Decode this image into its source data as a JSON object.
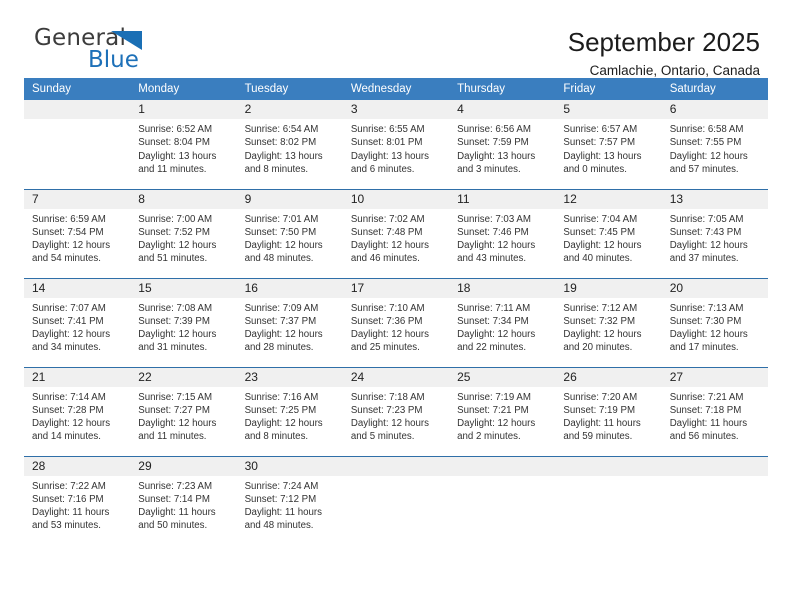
{
  "brand": {
    "name_top": "General",
    "name_bottom": "Blue",
    "triangle_color": "#1a6fb5"
  },
  "header": {
    "title": "September 2025",
    "subtitle": "Camlachie, Ontario, Canada"
  },
  "theme": {
    "header_row_bg": "#3a7ebf",
    "daynum_bg": "#f0f0f0",
    "row_divider": "#2f6fa8",
    "text": "#333333"
  },
  "weekdays": [
    "Sunday",
    "Monday",
    "Tuesday",
    "Wednesday",
    "Thursday",
    "Friday",
    "Saturday"
  ],
  "weeks": [
    [
      {
        "day": "",
        "lines": []
      },
      {
        "day": "1",
        "lines": [
          "Sunrise: 6:52 AM",
          "Sunset: 8:04 PM",
          "Daylight: 13 hours",
          "and 11 minutes."
        ]
      },
      {
        "day": "2",
        "lines": [
          "Sunrise: 6:54 AM",
          "Sunset: 8:02 PM",
          "Daylight: 13 hours",
          "and 8 minutes."
        ]
      },
      {
        "day": "3",
        "lines": [
          "Sunrise: 6:55 AM",
          "Sunset: 8:01 PM",
          "Daylight: 13 hours",
          "and 6 minutes."
        ]
      },
      {
        "day": "4",
        "lines": [
          "Sunrise: 6:56 AM",
          "Sunset: 7:59 PM",
          "Daylight: 13 hours",
          "and 3 minutes."
        ]
      },
      {
        "day": "5",
        "lines": [
          "Sunrise: 6:57 AM",
          "Sunset: 7:57 PM",
          "Daylight: 13 hours",
          "and 0 minutes."
        ]
      },
      {
        "day": "6",
        "lines": [
          "Sunrise: 6:58 AM",
          "Sunset: 7:55 PM",
          "Daylight: 12 hours",
          "and 57 minutes."
        ]
      }
    ],
    [
      {
        "day": "7",
        "lines": [
          "Sunrise: 6:59 AM",
          "Sunset: 7:54 PM",
          "Daylight: 12 hours",
          "and 54 minutes."
        ]
      },
      {
        "day": "8",
        "lines": [
          "Sunrise: 7:00 AM",
          "Sunset: 7:52 PM",
          "Daylight: 12 hours",
          "and 51 minutes."
        ]
      },
      {
        "day": "9",
        "lines": [
          "Sunrise: 7:01 AM",
          "Sunset: 7:50 PM",
          "Daylight: 12 hours",
          "and 48 minutes."
        ]
      },
      {
        "day": "10",
        "lines": [
          "Sunrise: 7:02 AM",
          "Sunset: 7:48 PM",
          "Daylight: 12 hours",
          "and 46 minutes."
        ]
      },
      {
        "day": "11",
        "lines": [
          "Sunrise: 7:03 AM",
          "Sunset: 7:46 PM",
          "Daylight: 12 hours",
          "and 43 minutes."
        ]
      },
      {
        "day": "12",
        "lines": [
          "Sunrise: 7:04 AM",
          "Sunset: 7:45 PM",
          "Daylight: 12 hours",
          "and 40 minutes."
        ]
      },
      {
        "day": "13",
        "lines": [
          "Sunrise: 7:05 AM",
          "Sunset: 7:43 PM",
          "Daylight: 12 hours",
          "and 37 minutes."
        ]
      }
    ],
    [
      {
        "day": "14",
        "lines": [
          "Sunrise: 7:07 AM",
          "Sunset: 7:41 PM",
          "Daylight: 12 hours",
          "and 34 minutes."
        ]
      },
      {
        "day": "15",
        "lines": [
          "Sunrise: 7:08 AM",
          "Sunset: 7:39 PM",
          "Daylight: 12 hours",
          "and 31 minutes."
        ]
      },
      {
        "day": "16",
        "lines": [
          "Sunrise: 7:09 AM",
          "Sunset: 7:37 PM",
          "Daylight: 12 hours",
          "and 28 minutes."
        ]
      },
      {
        "day": "17",
        "lines": [
          "Sunrise: 7:10 AM",
          "Sunset: 7:36 PM",
          "Daylight: 12 hours",
          "and 25 minutes."
        ]
      },
      {
        "day": "18",
        "lines": [
          "Sunrise: 7:11 AM",
          "Sunset: 7:34 PM",
          "Daylight: 12 hours",
          "and 22 minutes."
        ]
      },
      {
        "day": "19",
        "lines": [
          "Sunrise: 7:12 AM",
          "Sunset: 7:32 PM",
          "Daylight: 12 hours",
          "and 20 minutes."
        ]
      },
      {
        "day": "20",
        "lines": [
          "Sunrise: 7:13 AM",
          "Sunset: 7:30 PM",
          "Daylight: 12 hours",
          "and 17 minutes."
        ]
      }
    ],
    [
      {
        "day": "21",
        "lines": [
          "Sunrise: 7:14 AM",
          "Sunset: 7:28 PM",
          "Daylight: 12 hours",
          "and 14 minutes."
        ]
      },
      {
        "day": "22",
        "lines": [
          "Sunrise: 7:15 AM",
          "Sunset: 7:27 PM",
          "Daylight: 12 hours",
          "and 11 minutes."
        ]
      },
      {
        "day": "23",
        "lines": [
          "Sunrise: 7:16 AM",
          "Sunset: 7:25 PM",
          "Daylight: 12 hours",
          "and 8 minutes."
        ]
      },
      {
        "day": "24",
        "lines": [
          "Sunrise: 7:18 AM",
          "Sunset: 7:23 PM",
          "Daylight: 12 hours",
          "and 5 minutes."
        ]
      },
      {
        "day": "25",
        "lines": [
          "Sunrise: 7:19 AM",
          "Sunset: 7:21 PM",
          "Daylight: 12 hours",
          "and 2 minutes."
        ]
      },
      {
        "day": "26",
        "lines": [
          "Sunrise: 7:20 AM",
          "Sunset: 7:19 PM",
          "Daylight: 11 hours",
          "and 59 minutes."
        ]
      },
      {
        "day": "27",
        "lines": [
          "Sunrise: 7:21 AM",
          "Sunset: 7:18 PM",
          "Daylight: 11 hours",
          "and 56 minutes."
        ]
      }
    ],
    [
      {
        "day": "28",
        "lines": [
          "Sunrise: 7:22 AM",
          "Sunset: 7:16 PM",
          "Daylight: 11 hours",
          "and 53 minutes."
        ]
      },
      {
        "day": "29",
        "lines": [
          "Sunrise: 7:23 AM",
          "Sunset: 7:14 PM",
          "Daylight: 11 hours",
          "and 50 minutes."
        ]
      },
      {
        "day": "30",
        "lines": [
          "Sunrise: 7:24 AM",
          "Sunset: 7:12 PM",
          "Daylight: 11 hours",
          "and 48 minutes."
        ]
      },
      {
        "day": "",
        "lines": []
      },
      {
        "day": "",
        "lines": []
      },
      {
        "day": "",
        "lines": []
      },
      {
        "day": "",
        "lines": []
      }
    ]
  ]
}
